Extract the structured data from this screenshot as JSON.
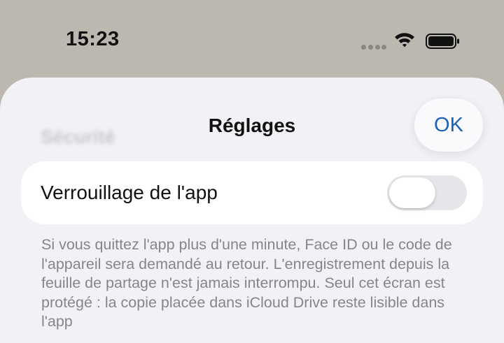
{
  "status_bar": {
    "time": "15:23",
    "icons": [
      "signal-dots",
      "wifi-icon",
      "battery-icon"
    ]
  },
  "sheet": {
    "background_section_title": "Sécurité",
    "title": "Réglages",
    "ok_label": "OK",
    "accent_color": "#1b63b7"
  },
  "settings": {
    "app_lock": {
      "label": "Verrouillage de l'app",
      "enabled": false
    }
  },
  "footnote": "Si vous quittez l'app plus d'une minute, Face ID ou le code de l'appareil sera demandé au retour. L'enregistrement depuis la feuille de partage n'est jamais interrompu. Seul cet écran est protégé : la copie placée dans iCloud Drive reste lisible dans l'app"
}
